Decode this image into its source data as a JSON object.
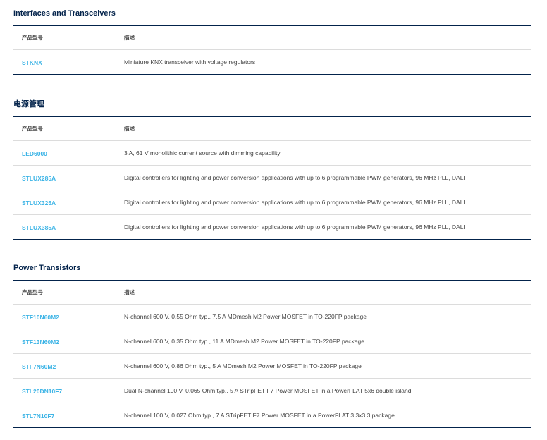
{
  "sections": [
    {
      "title": "Interfaces and Transceivers",
      "col_part": "产品型号",
      "col_desc": "描述",
      "rows": [
        {
          "part": "STKNX",
          "desc": "Miniature KNX transceiver with voltage regulators"
        }
      ]
    },
    {
      "title": "电源管理",
      "col_part": "产品型号",
      "col_desc": "描述",
      "rows": [
        {
          "part": "LED6000",
          "desc": "3 A, 61 V monolithic current source with dimming capability"
        },
        {
          "part": "STLUX285A",
          "desc": "Digital controllers for lighting and power conversion applications with up to 6 programmable PWM generators, 96 MHz PLL, DALI"
        },
        {
          "part": "STLUX325A",
          "desc": "Digital controllers for lighting and power conversion applications with up to 6 programmable PWM generators, 96 MHz PLL, DALI"
        },
        {
          "part": "STLUX385A",
          "desc": "Digital controllers for lighting and power conversion applications with up to 6 programmable PWM generators, 96 MHz PLL, DALI"
        }
      ]
    },
    {
      "title": "Power Transistors",
      "col_part": "产品型号",
      "col_desc": "描述",
      "rows": [
        {
          "part": "STF10N60M2",
          "desc": "N-channel 600 V, 0.55 Ohm typ., 7.5 A MDmesh M2 Power MOSFET in TO-220FP package"
        },
        {
          "part": "STF13N60M2",
          "desc": "N-channel 600 V, 0.35 Ohm typ., 11 A MDmesh M2 Power MOSFET in TO-220FP package"
        },
        {
          "part": "STF7N60M2",
          "desc": "N-channel 600 V, 0.86 Ohm typ., 5 A MDmesh M2 Power MOSFET in TO-220FP package"
        },
        {
          "part": "STL20DN10F7",
          "desc": "Dual N-channel 100 V, 0.065 Ohm typ., 5 A STripFET F7 Power MOSFET in a PowerFLAT 5x6 double island"
        },
        {
          "part": "STL7N10F7",
          "desc": "N-channel 100 V, 0.027 Ohm typ., 7 A STripFET F7 Power MOSFET in a PowerFLAT 3.3x3.3 package"
        }
      ]
    }
  ]
}
